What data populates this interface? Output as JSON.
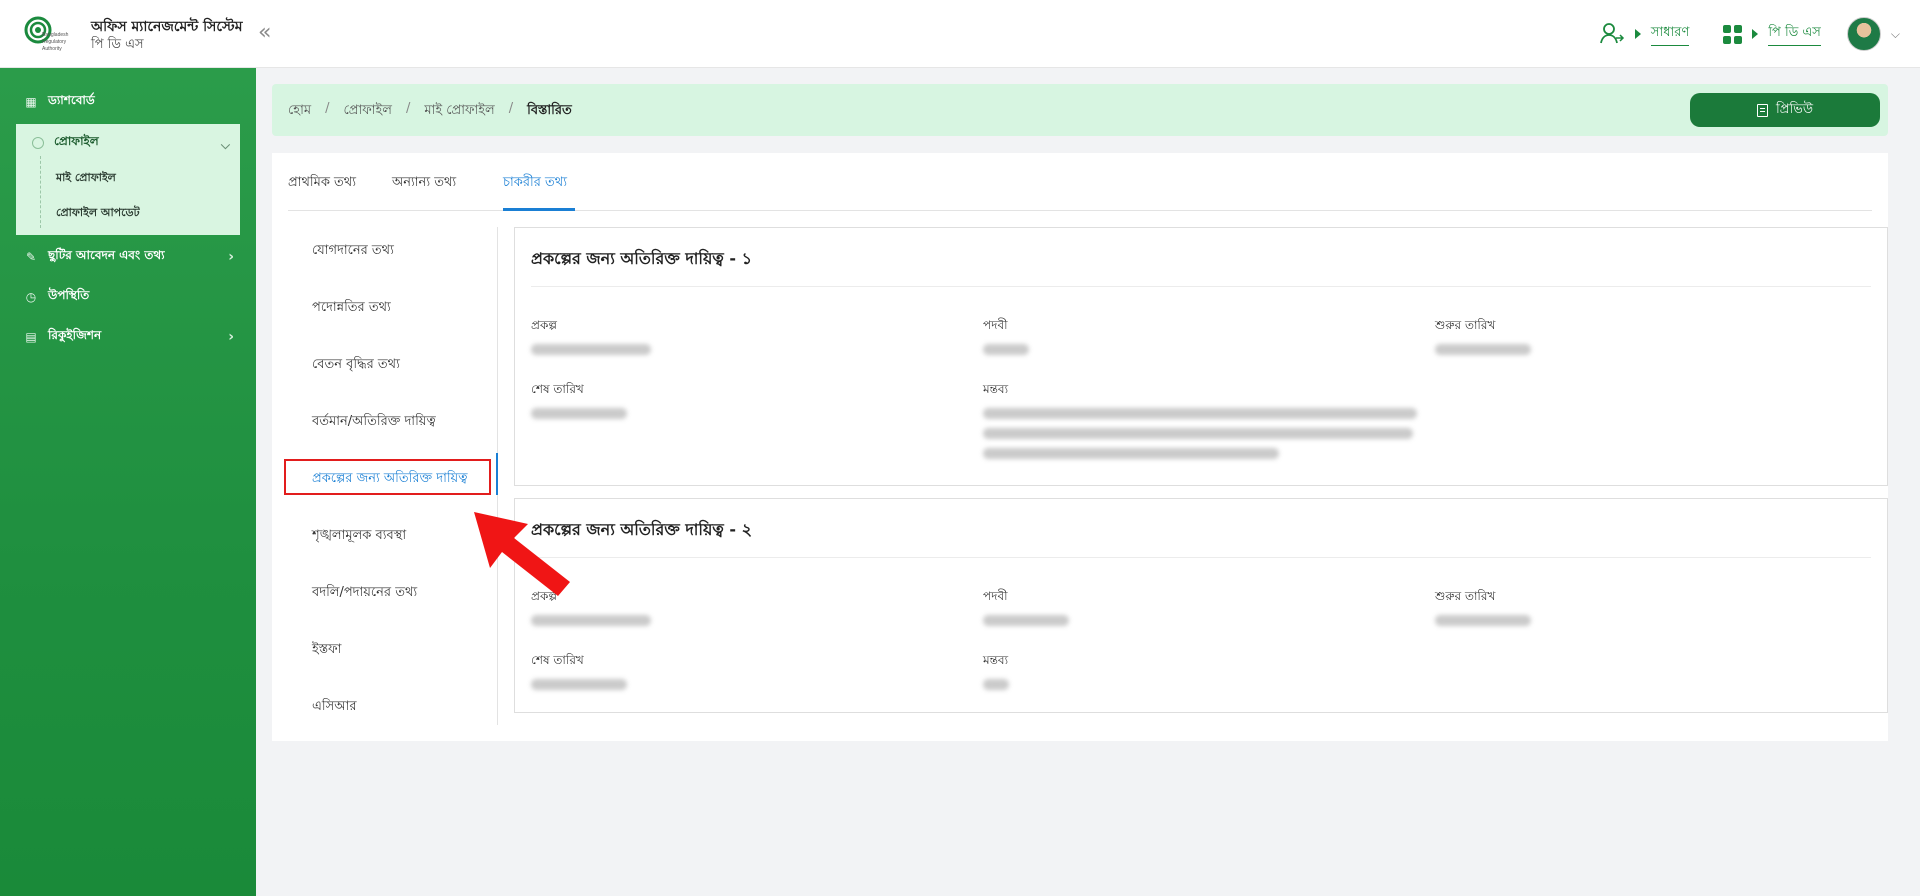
{
  "header": {
    "app_title": "অফিস ম্যানেজমেন্ট সিস্টেম",
    "app_subtitle": "পি ডি এস",
    "role_link": "সাধারণ",
    "module_link": "পি ডি এস",
    "logo_text": "Bangladesh Regulatory Authority"
  },
  "sidebar": {
    "items": [
      {
        "label": "ড্যাশবোর্ড",
        "icon": "dashboard-icon"
      },
      {
        "label": "প্রোফাইল",
        "icon": "profile-icon"
      },
      {
        "label": "ছুটির আবেদন এবং তথ্য",
        "icon": "leave-icon"
      },
      {
        "label": "উপস্থিতি",
        "icon": "clock-icon"
      },
      {
        "label": "রিকুইজিশন",
        "icon": "requisition-icon"
      }
    ],
    "profile_sub": [
      "মাই প্রোফাইল",
      "প্রোফাইল আপডেট"
    ]
  },
  "breadcrumb": [
    "হোম",
    "প্রোফাইল",
    "মাই প্রোফাইল",
    "বিস্তারিত"
  ],
  "preview_button": "প্রিভিউ",
  "tabs": [
    "প্রাথমিক তথ্য",
    "অন্যান্য তথ্য",
    "চাকরীর তথ্য"
  ],
  "active_tab": "চাকরীর তথ্য",
  "side_menu": [
    "যোগদানের তথ্য",
    "পদোন্নতির তথ্য",
    "বেতন বৃদ্ধির তথ্য",
    "বর্তমান/অতিরিক্ত দায়িত্ব",
    "প্রকল্পের জন্য অতিরিক্ত দায়িত্ব",
    "শৃঙ্খলামূলক ব্যবস্থা",
    "বদলি/পদায়নের তথ্য",
    "ইস্তফা",
    "এসিআর"
  ],
  "active_side_menu": "প্রকল্পের জন্য অতিরিক্ত দায়িত্ব",
  "panels": [
    {
      "title": "প্রকল্পের জন্য অতিরিক্ত দায়িত্ব - ১",
      "labels": {
        "project": "প্রকল্প",
        "designation": "পদবী",
        "start_date": "শুরুর তারিখ",
        "end_date": "শেষ তারিখ",
        "remarks": "মন্তব্য"
      }
    },
    {
      "title": "প্রকল্পের জন্য অতিরিক্ত দায়িত্ব - ২",
      "labels": {
        "project": "প্রকল্প",
        "designation": "পদবী",
        "start_date": "শুরুর তারিখ",
        "end_date": "শেষ তারিখ",
        "remarks": "মন্তব্য"
      }
    }
  ],
  "colors": {
    "brand_green": "#1b7a3a",
    "active_blue": "#1a7fd4",
    "highlight_red": "#e21d1d",
    "crumb_bg": "#d7f5e1"
  }
}
